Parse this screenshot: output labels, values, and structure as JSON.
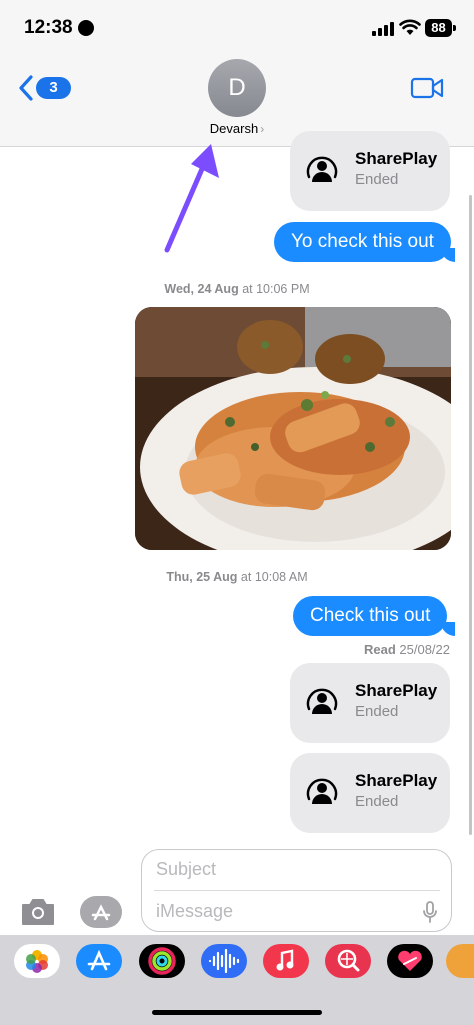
{
  "status_bar": {
    "time": "12:38",
    "battery": "88"
  },
  "header": {
    "back_badge": "3",
    "avatar_initial": "D",
    "contact_name": "Devarsh",
    "name_chevron": "›"
  },
  "messages": {
    "shareplay_1": {
      "title": "SharePlay",
      "status": "Ended"
    },
    "outgoing_1": "Yo check this out",
    "timestamp_1_day": "Wed, 24 Aug",
    "timestamp_1_time": "at 10:06 PM",
    "timestamp_2_day": "Thu, 25 Aug",
    "timestamp_2_time": "at 10:08 AM",
    "outgoing_2": "Check this out",
    "read_label": "Read",
    "read_date": "25/08/22",
    "shareplay_2": {
      "title": "SharePlay",
      "status": "Ended"
    },
    "shareplay_3": {
      "title": "SharePlay",
      "status": "Ended"
    }
  },
  "compose": {
    "subject_placeholder": "Subject",
    "message_placeholder": "iMessage"
  },
  "app_strip": {
    "apps": [
      "photos-app",
      "app-store-app",
      "fitness-app",
      "voice-memo-app",
      "music-app",
      "image-search-app",
      "digital-touch-app",
      "memoji-app"
    ]
  },
  "colors": {
    "accent_blue": "#1a8cff",
    "incoming_gray": "#e9e9eb",
    "annotation_purple": "#7b4dff"
  }
}
